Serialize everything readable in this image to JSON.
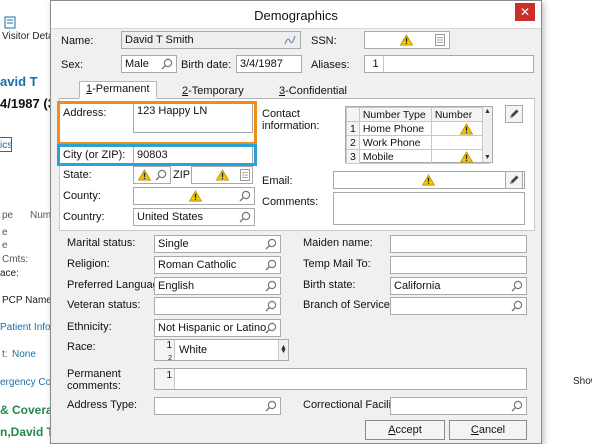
{
  "background": {
    "visitor_label": "Visitor Detail",
    "name_frag": "avid T",
    "dob_frag": "4/1987 (3",
    "link_frag": "ics",
    "type_label": "pe",
    "num_label": "Num",
    "e1": "e",
    "e2": "e",
    "cmts": "Cmts:",
    "ace": "ace:",
    "pcp": "PCP Name:",
    "patient_info": "Patient Info",
    "t_none_label": "t:",
    "t_none_value": "None",
    "ergency": "ergency Cont",
    "coverage": "& Coverag",
    "name_bottom": "n,David T",
    "show": "Show"
  },
  "dialog": {
    "title": "Demographics",
    "close": "✕",
    "name_label": "Name:",
    "name_value": "David T Smith",
    "ssn_label": "SSN:",
    "sex_label": "Sex:",
    "sex_value": "Male",
    "birth_label": "Birth date:",
    "birth_value": "3/4/1987",
    "aliases_label": "Aliases:",
    "aliases_count": "1",
    "tabs": [
      {
        "key": "1",
        "label": "-Permanent"
      },
      {
        "key": "2",
        "label": "-Temporary"
      },
      {
        "key": "3",
        "label": "-Confidential"
      }
    ],
    "address_label": "Address:",
    "address_value": "123 Happy LN",
    "city_label": "City (or ZIP):",
    "city_value": "90803",
    "state_label": "State:",
    "zip_label": "ZIP:",
    "county_label": "County:",
    "country_label": "Country:",
    "country_value": "United States",
    "contact_label_1": "Contact",
    "contact_label_2": "information:",
    "contact_headers": [
      "Number Type",
      "Number"
    ],
    "contact_rows": [
      {
        "n": "1",
        "type": "Home Phone",
        "warn": true
      },
      {
        "n": "2",
        "type": "Work Phone",
        "warn": false
      },
      {
        "n": "3",
        "type": "Mobile",
        "warn": true
      }
    ],
    "email_label": "Email:",
    "comments_label": "Comments:",
    "marital_label": "Marital status:",
    "marital_value": "Single",
    "maiden_label": "Maiden name:",
    "religion_label": "Religion:",
    "religion_value": "Roman Catholic",
    "tempmail_label": "Temp Mail To:",
    "language_label": "Preferred Language:",
    "language_value": "English",
    "birthstate_label": "Birth state:",
    "birthstate_value": "California",
    "veteran_label": "Veteran status:",
    "branch_label": "Branch of Service:",
    "ethnicity_label": "Ethnicity:",
    "ethnicity_value": "Not Hispanic or Latino",
    "race_label": "Race:",
    "race_n1": "1",
    "race_value": "White",
    "race_n2": "2",
    "perm_comments_1": "Permanent",
    "perm_comments_2": "comments:",
    "perm_comments_n": "1",
    "address_type_label": "Address Type:",
    "correctional_label": "Correctional Facility:",
    "accept_key": "A",
    "accept_rest": "ccept",
    "cancel_key": "C",
    "cancel_rest": "ancel"
  },
  "colors": {
    "highlight_address": "#f28a1e",
    "highlight_city": "#2aa1d8",
    "warning": "#f2c500"
  }
}
